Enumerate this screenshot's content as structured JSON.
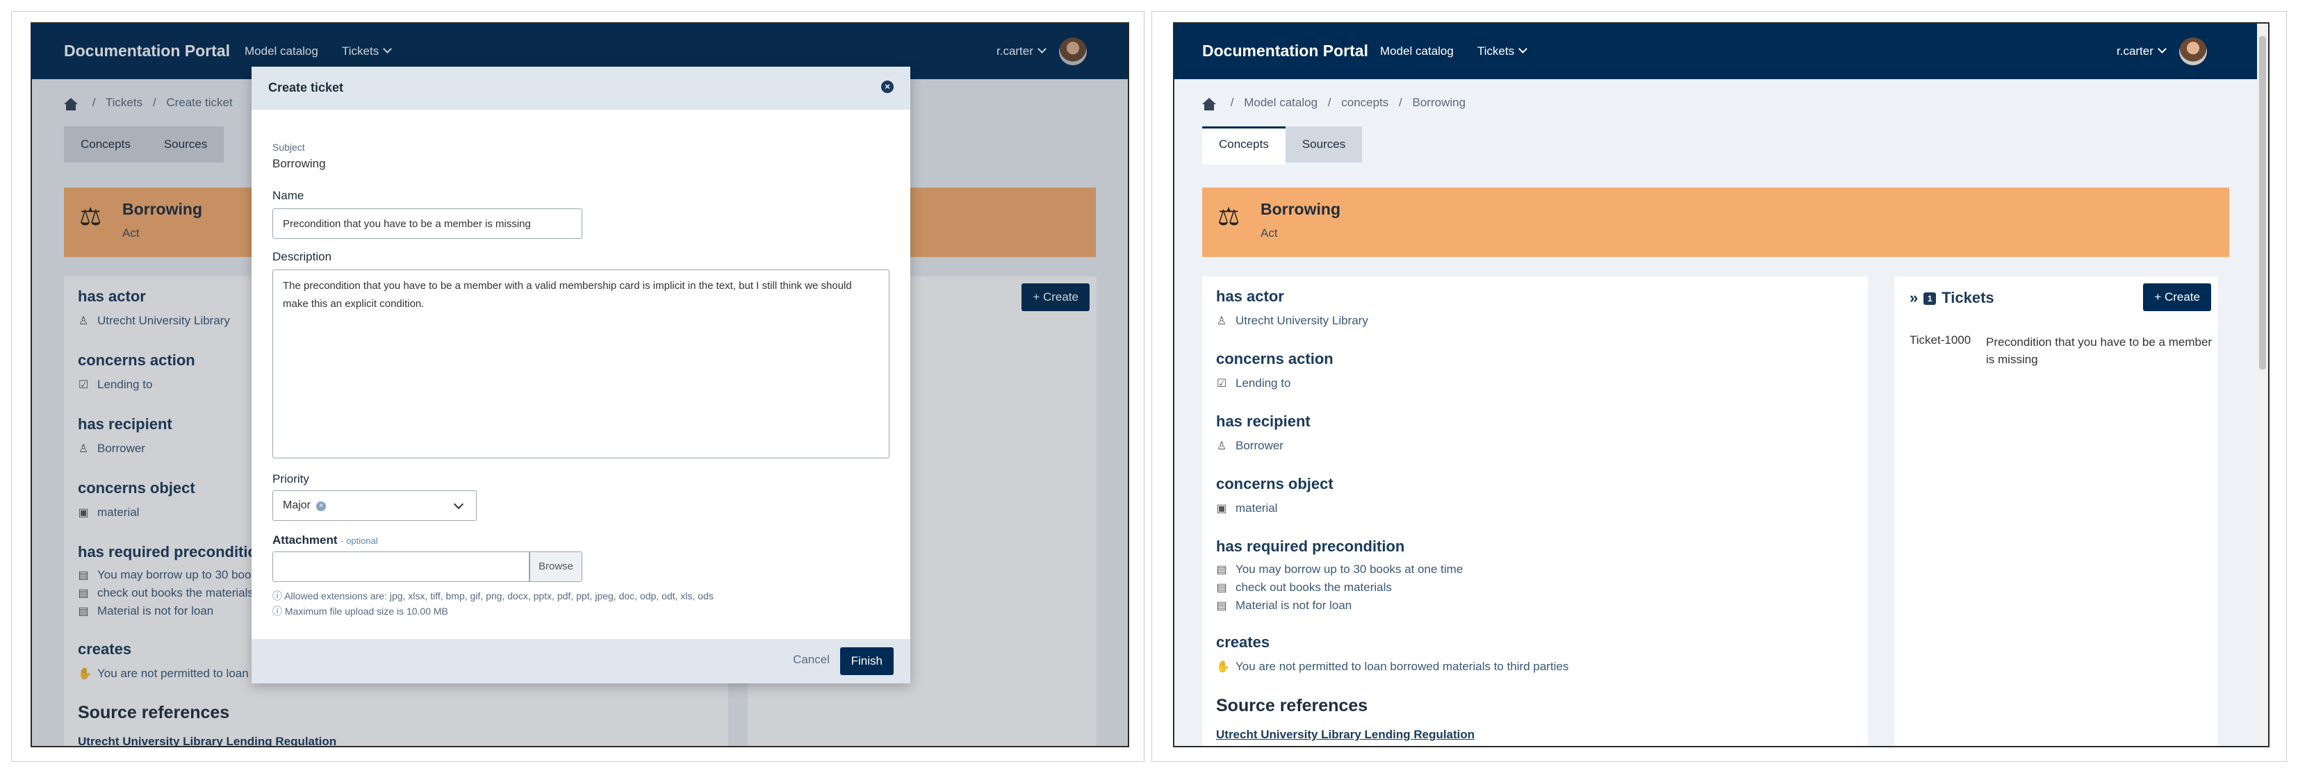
{
  "nav": {
    "brand": "Documentation Portal",
    "model_catalog": "Model catalog",
    "tickets": "Tickets",
    "user": "r.carter"
  },
  "left": {
    "breadcrumb": [
      "Tickets",
      "Create ticket"
    ],
    "tabs": [
      "Concepts",
      "Sources"
    ],
    "create_label": "+ Create"
  },
  "right": {
    "breadcrumb": [
      "Model catalog",
      "concepts",
      "Borrowing"
    ],
    "tabs": [
      "Concepts",
      "Sources"
    ]
  },
  "concept": {
    "title": "Borrowing",
    "subtitle": "Act"
  },
  "props": {
    "has_actor": "has actor",
    "actor": "Utrecht University Library",
    "concerns_action": "concerns action",
    "action": "Lending to",
    "has_recipient": "has recipient",
    "recipient": "Borrower",
    "concerns_object": "concerns object",
    "object": "material",
    "has_required_precondition": "has required precondition",
    "preconditions": [
      "You may borrow up to 30 books at one time",
      "check out books the materials",
      "Material is not for loan"
    ],
    "creates": "creates",
    "creates_item": "You are not permitted to loan borrowed materials to third parties",
    "source_references": "Source references",
    "source_link": "Utrecht University Library Lending Regulation"
  },
  "left_truncated": {
    "precondition_1": "You may borrow up to 30 boo",
    "precondition_2": "check out books the materials",
    "creates_item": "You are not permitted to loan"
  },
  "tickets_panel": {
    "title": "Tickets",
    "badge": "1",
    "create_label": "+ Create",
    "ticket_id": "Ticket-1000",
    "ticket_subject": "Precondition that you have to be a member is missing"
  },
  "modal": {
    "title": "Create ticket",
    "subject_label": "Subject",
    "subject_value": "Borrowing",
    "name_label": "Name",
    "name_value": "Precondition that you have to be a member is missing",
    "description_label": "Description",
    "description_value": "The precondition that you have to be a member with a valid membership card is implicit in the text, but I still think we should make this an explicit condition.",
    "priority_label": "Priority",
    "priority_value": "Major",
    "attachment_label": "Attachment",
    "attachment_optional": "- optional",
    "browse": "Browse",
    "hint_ext": "ⓘ Allowed extensions are: jpg, xlsx, tiff, bmp, gif, png, docx, pptx, pdf, ppt, jpeg, doc, odp, odt, xls, ods",
    "hint_size": "ⓘ Maximum file upload size is 10.00 MB",
    "cancel": "Cancel",
    "finish": "Finish"
  },
  "colors": {
    "navy": "#002b54",
    "banner": "#f5ad6f",
    "page_bg": "#eef1f6"
  }
}
